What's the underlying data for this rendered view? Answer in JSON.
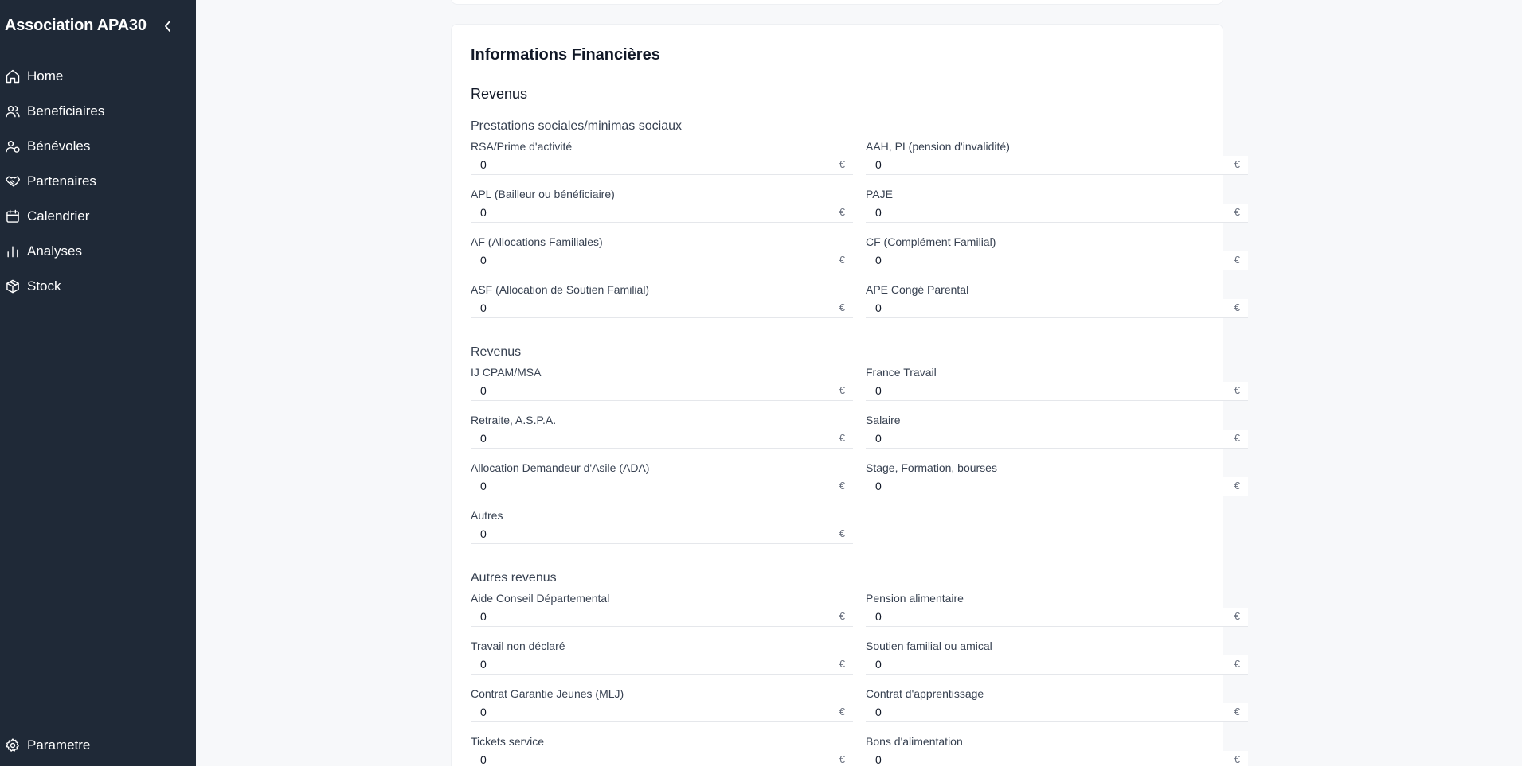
{
  "sidebar": {
    "title": "Association APA30",
    "items": [
      {
        "label": "Home",
        "icon": "home-icon"
      },
      {
        "label": "Beneficiaires",
        "icon": "users-icon"
      },
      {
        "label": "Bénévoles",
        "icon": "user-check-icon"
      },
      {
        "label": "Partenaires",
        "icon": "handshake-icon"
      },
      {
        "label": "Calendrier",
        "icon": "calendar-icon"
      },
      {
        "label": "Analyses",
        "icon": "bar-chart-icon"
      },
      {
        "label": "Stock",
        "icon": "package-icon"
      }
    ],
    "settings": {
      "label": "Parametre",
      "icon": "gear-icon"
    }
  },
  "main": {
    "card_title": "Informations Financières",
    "section_title": "Revenus",
    "currency": "€",
    "groups": [
      {
        "title": "Prestations sociales/minimas sociaux",
        "fields": [
          {
            "label": "RSA/Prime d'activité",
            "value": "0"
          },
          {
            "label": "AAH, PI (pension d'invalidité)",
            "value": "0"
          },
          {
            "label": "APL (Bailleur ou bénéficiaire)",
            "value": "0"
          },
          {
            "label": "PAJE",
            "value": "0"
          },
          {
            "label": "AF (Allocations Familiales)",
            "value": "0"
          },
          {
            "label": "CF (Complément Familial)",
            "value": "0"
          },
          {
            "label": "ASF (Allocation de Soutien Familial)",
            "value": "0"
          },
          {
            "label": "APE Congé Parental",
            "value": "0"
          }
        ]
      },
      {
        "title": "Revenus",
        "fields": [
          {
            "label": "IJ CPAM/MSA",
            "value": "0"
          },
          {
            "label": "France Travail",
            "value": "0"
          },
          {
            "label": "Retraite, A.S.P.A.",
            "value": "0"
          },
          {
            "label": "Salaire",
            "value": "0"
          },
          {
            "label": "Allocation Demandeur d'Asile (ADA)",
            "value": "0"
          },
          {
            "label": "Stage, Formation, bourses",
            "value": "0"
          },
          {
            "label": "Autres",
            "value": "0"
          }
        ]
      },
      {
        "title": "Autres revenus",
        "fields": [
          {
            "label": "Aide Conseil Départemental",
            "value": "0"
          },
          {
            "label": "Pension alimentaire",
            "value": "0"
          },
          {
            "label": "Travail non déclaré",
            "value": "0"
          },
          {
            "label": "Soutien familial ou amical",
            "value": "0"
          },
          {
            "label": "Contrat Garantie Jeunes (MLJ)",
            "value": "0"
          },
          {
            "label": "Contrat d'apprentissage",
            "value": "0"
          },
          {
            "label": "Tickets service",
            "value": "0"
          },
          {
            "label": "Bons d'alimentation",
            "value": "0"
          }
        ]
      }
    ]
  }
}
